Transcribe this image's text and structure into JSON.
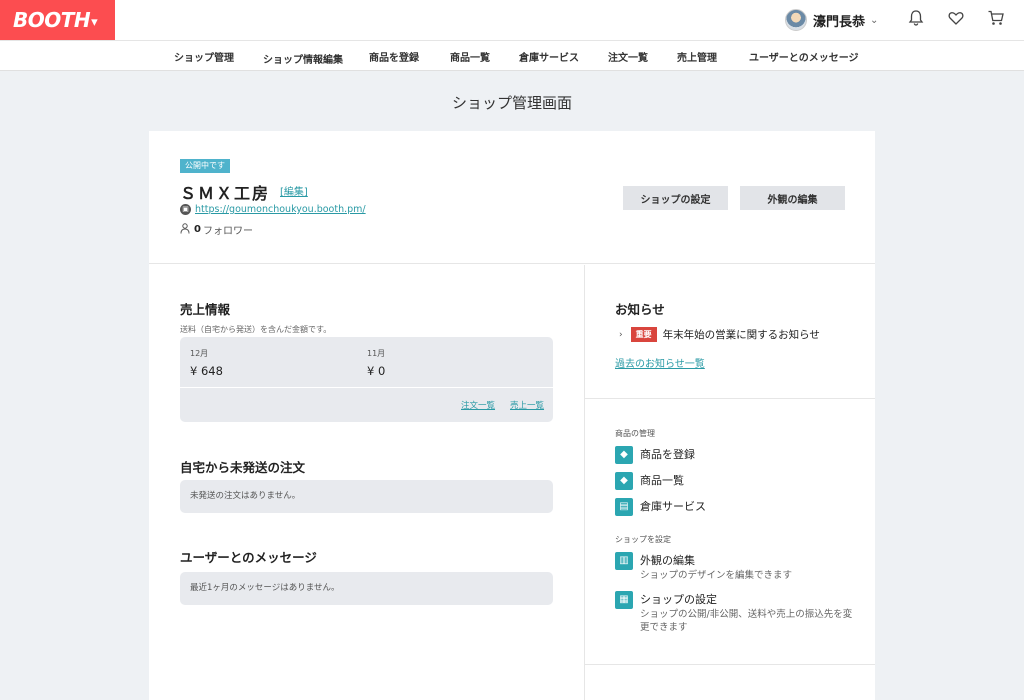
{
  "header": {
    "logo_text": "BOOTH",
    "user_name": "濠門長恭"
  },
  "nav": {
    "items": [
      "ショップ管理",
      "ショップ情報編集",
      "商品を登録",
      "商品一覧",
      "倉庫サービス",
      "注文一覧",
      "売上管理",
      "ユーザーとのメッセージ"
    ]
  },
  "page_title": "ショップ管理画面",
  "shop": {
    "status_badge": "公開中です",
    "name": "ＳＭＸ工房",
    "edit_label": "[編集]",
    "url": "https://goumonchoukyou.booth.pm/",
    "follower_count": "0",
    "follower_label": "フォロワー",
    "settings_button": "ショップの設定",
    "design_button": "外観の編集"
  },
  "sales": {
    "title": "売上情報",
    "note": "送料（自宅から発送）を含んだ金額です。",
    "months": [
      {
        "label": "12月",
        "amount": "¥ 648"
      },
      {
        "label": "11月",
        "amount": "¥ 0"
      }
    ],
    "orders_link": "注文一覧",
    "sales_link": "売上一覧"
  },
  "unshipped": {
    "title": "自宅から未発送の注文",
    "empty_text": "未発送の注文はありません。"
  },
  "messages": {
    "title": "ユーザーとのメッセージ",
    "empty_text": "最近1ヶ月のメッセージはありません。"
  },
  "news": {
    "title": "お知らせ",
    "tag": "重要",
    "item": "年末年始の営業に関するお知らせ",
    "all_link": "過去のお知らせ一覧"
  },
  "product_mgmt": {
    "label": "商品の管理",
    "items": [
      {
        "label": "商品を登録",
        "icon": "diamond-icon"
      },
      {
        "label": "商品一覧",
        "icon": "diamond-icon"
      },
      {
        "label": "倉庫サービス",
        "icon": "warehouse-icon"
      }
    ]
  },
  "shop_settings": {
    "label": "ショップを設定",
    "items": [
      {
        "label": "外観の編集",
        "desc": "ショップのデザインを編集できます",
        "icon": "design-icon"
      },
      {
        "label": "ショップの設定",
        "desc": "ショップの公開/非公開、送料や売上の振込先を変更できます",
        "icon": "settings-icon"
      }
    ]
  },
  "colors": {
    "brand": "#fc4d50",
    "accent": "#2ba6b1",
    "badge": "#4fb3cc",
    "important": "#d9453d"
  }
}
